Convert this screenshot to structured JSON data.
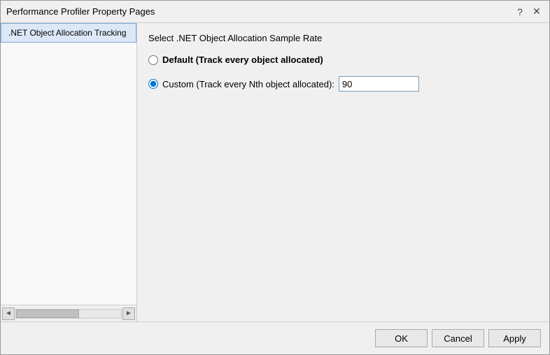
{
  "window": {
    "title": "Performance Profiler Property Pages",
    "help_btn": "?",
    "close_btn": "✕"
  },
  "sidebar": {
    "selected_item": ".NET Object Allocation Tracking",
    "scroll_left": "◄",
    "scroll_right": "►"
  },
  "content": {
    "section_title": "Select .NET Object Allocation Sample Rate",
    "option_default_label": "Default (Track every object allocated)",
    "option_custom_label": "Custom (Track every Nth object allocated):",
    "custom_value": "90"
  },
  "footer": {
    "ok_label": "OK",
    "cancel_label": "Cancel",
    "apply_label": "Apply"
  }
}
